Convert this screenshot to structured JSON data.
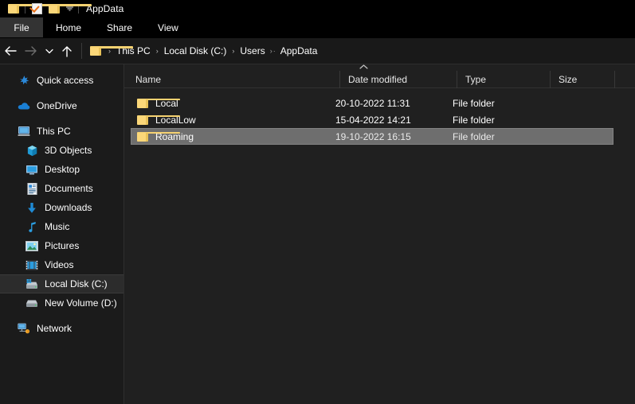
{
  "titlebar": {
    "title": "AppData",
    "quick_access": [
      {
        "name": "folder-icon",
        "label": "Pin to Quick access"
      },
      {
        "name": "properties-icon",
        "label": "Properties"
      },
      {
        "name": "new-folder-icon",
        "label": "New folder"
      },
      {
        "name": "chevron-down-icon",
        "label": "Customize Quick Access Toolbar"
      }
    ]
  },
  "ribbon": {
    "tabs": [
      {
        "label": "File",
        "active": true
      },
      {
        "label": "Home",
        "active": false
      },
      {
        "label": "Share",
        "active": false
      },
      {
        "label": "View",
        "active": false
      }
    ]
  },
  "addressbar": {
    "back_icon": "back-arrow-icon",
    "forward_icon": "forward-arrow-icon",
    "recent_icon": "chevron-down-icon",
    "up_icon": "up-arrow-icon",
    "folder_icon": "folder-icon",
    "breadcrumb": [
      {
        "label": "This PC"
      },
      {
        "label": "Local Disk (C:)"
      },
      {
        "label": "Users"
      },
      {
        "label": "AppData"
      }
    ],
    "separator": "›",
    "ellipsis_separator": "›·"
  },
  "sidebar": {
    "items": [
      {
        "label": "Quick access",
        "icon": "star-icon",
        "indent": false,
        "selected": false
      },
      {
        "label": "OneDrive",
        "icon": "cloud-icon",
        "indent": false,
        "selected": false
      },
      {
        "label": "This PC",
        "icon": "computer-icon",
        "indent": false,
        "selected": false
      },
      {
        "label": "3D Objects",
        "icon": "cube-icon",
        "indent": true,
        "selected": false
      },
      {
        "label": "Desktop",
        "icon": "desktop-icon",
        "indent": true,
        "selected": false
      },
      {
        "label": "Documents",
        "icon": "document-icon",
        "indent": true,
        "selected": false
      },
      {
        "label": "Downloads",
        "icon": "download-arrow-icon",
        "indent": true,
        "selected": false
      },
      {
        "label": "Music",
        "icon": "music-note-icon",
        "indent": true,
        "selected": false
      },
      {
        "label": "Pictures",
        "icon": "picture-icon",
        "indent": true,
        "selected": false
      },
      {
        "label": "Videos",
        "icon": "video-icon",
        "indent": true,
        "selected": false
      },
      {
        "label": "Local Disk (C:)",
        "icon": "windows-drive-icon",
        "indent": true,
        "selected": true
      },
      {
        "label": "New Volume (D:)",
        "icon": "drive-icon",
        "indent": true,
        "selected": false
      },
      {
        "label": "Network",
        "icon": "network-icon",
        "indent": false,
        "selected": false
      }
    ]
  },
  "filelist": {
    "sort_column": "Name",
    "sort_direction": "ascending",
    "sort_icon": "chevron-up-icon",
    "columns": [
      {
        "label": "Name"
      },
      {
        "label": "Date modified"
      },
      {
        "label": "Type"
      },
      {
        "label": "Size"
      }
    ],
    "rows": [
      {
        "name": "Local",
        "date": "20-10-2022 11:31",
        "type": "File folder",
        "size": "",
        "icon": "folder-icon",
        "selected": false
      },
      {
        "name": "LocalLow",
        "date": "15-04-2022 14:21",
        "type": "File folder",
        "size": "",
        "icon": "folder-icon",
        "selected": false
      },
      {
        "name": "Roaming",
        "date": "19-10-2022 16:15",
        "type": "File folder",
        "size": "",
        "icon": "folder-icon",
        "selected": true
      }
    ]
  },
  "colors": {
    "window_bg": "#000000",
    "sidebar_bg": "#1b1b1b",
    "content_bg": "#202020",
    "selection_bg": "#6e6e6e",
    "accent_blue": "#2b88d8",
    "folder_yellow": "#fbd779",
    "text": "#ffffff"
  }
}
